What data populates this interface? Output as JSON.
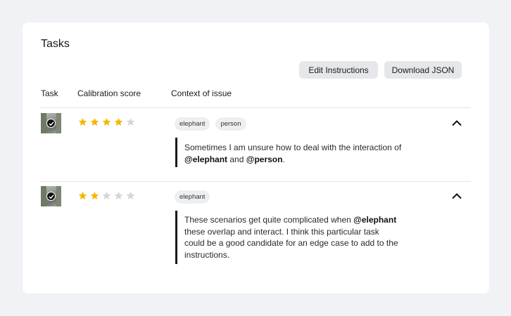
{
  "page": {
    "title": "Tasks",
    "buttons": {
      "edit": "Edit Instructions",
      "download": "Download JSON"
    },
    "columns": {
      "task": "Task",
      "score": "Calibration score",
      "context": "Context of issue"
    }
  },
  "rows": [
    {
      "rating": 4,
      "max_rating": 5,
      "tags": [
        "elephant",
        "person"
      ],
      "comment": {
        "line1": "Sometimes I am unsure how to deal with the interaction of",
        "mention1": "@elephant",
        "and": " and ",
        "mention2": "@person",
        "end": "."
      }
    },
    {
      "rating": 2,
      "max_rating": 5,
      "tags": [
        "elephant"
      ],
      "comment": {
        "start": "These scenarios get quite complicated when ",
        "mention1": "@elephant",
        "rest": "these overlap and interact. I think this particular task could be a good candidate for an edge case to add to the instructions."
      }
    }
  ],
  "colors": {
    "star_filled": "#f5b800",
    "star_empty": "#d4d6da",
    "page_bg": "#f1f2f5",
    "card_bg": "#ffffff",
    "button_bg": "#e6e7ea",
    "quote_border": "#1a1a1a"
  },
  "icons": {
    "star": "star-icon",
    "chevron": "chevron-up-icon",
    "check": "check-circle-icon"
  }
}
